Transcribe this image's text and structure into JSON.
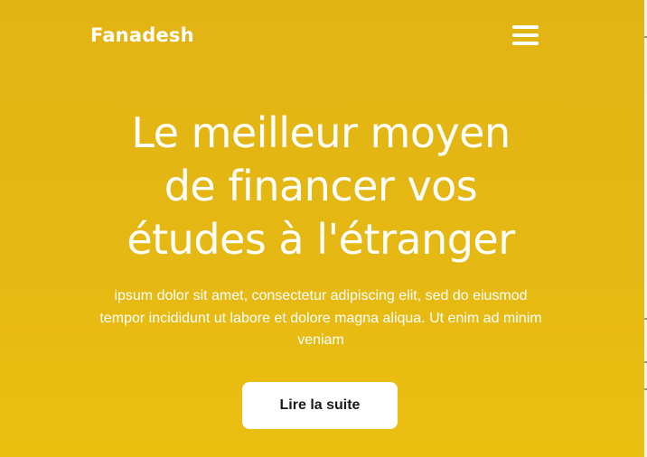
{
  "brand": {
    "name": "Fanadesh"
  },
  "nav": {
    "menu_icon": "hamburger-menu-icon"
  },
  "hero": {
    "title_line_1": "Le meilleur moyen",
    "title_line_2": "de financer vos",
    "title_line_3": "études à l'étranger",
    "subtitle": "ipsum dolor sit amet, consectetur adipiscing elit, sed do eiusmod tempor incididunt ut labore et dolore magna aliqua. Ut enim ad minim veniam",
    "cta_label": "Lire la suite"
  },
  "colors": {
    "background": "#e4b614",
    "text": "#ffffff",
    "button_background": "#ffffff",
    "button_text": "#1a1a1a"
  }
}
